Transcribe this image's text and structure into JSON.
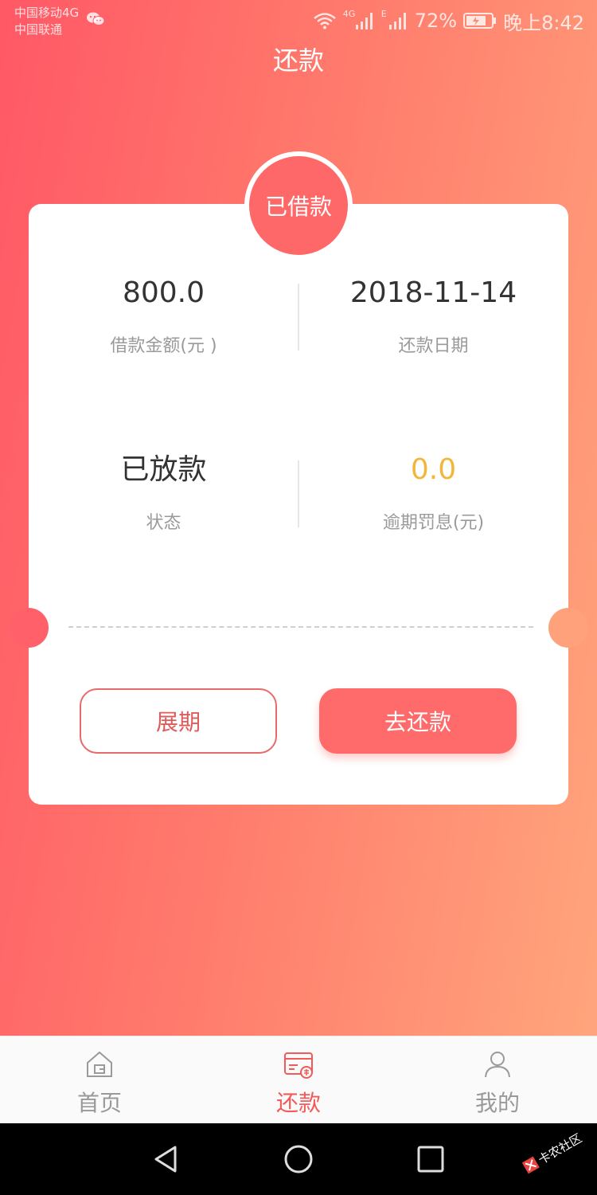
{
  "status_bar": {
    "carrier_1": "中国移动4G",
    "carrier_2": "中国联通",
    "net_1": "4G",
    "net_2": "E",
    "battery": "72%",
    "time": "晚上8:42"
  },
  "header": {
    "title": "还款"
  },
  "card": {
    "badge": "已借款",
    "loan_amount": {
      "value": "800.0",
      "label": "借款金额(元 )"
    },
    "repay_date": {
      "value": "2018-11-14",
      "label": "还款日期"
    },
    "status": {
      "value": "已放款",
      "label": "状态"
    },
    "overdue_fee": {
      "value": "0.0",
      "label": "逾期罚息(元)"
    },
    "extend_button": "展期",
    "repay_button": "去还款"
  },
  "tab_bar": {
    "items": [
      {
        "label": "首页",
        "icon": "home-icon",
        "active": false
      },
      {
        "label": "还款",
        "icon": "repay-card-icon",
        "active": true
      },
      {
        "label": "我的",
        "icon": "user-icon",
        "active": false
      }
    ]
  },
  "colors": {
    "accent": "#ff6b6b",
    "warning_value": "#f3b63c",
    "gradient_start": "#ff5866",
    "gradient_end": "#ffa57c"
  },
  "watermark": "卡农社区"
}
